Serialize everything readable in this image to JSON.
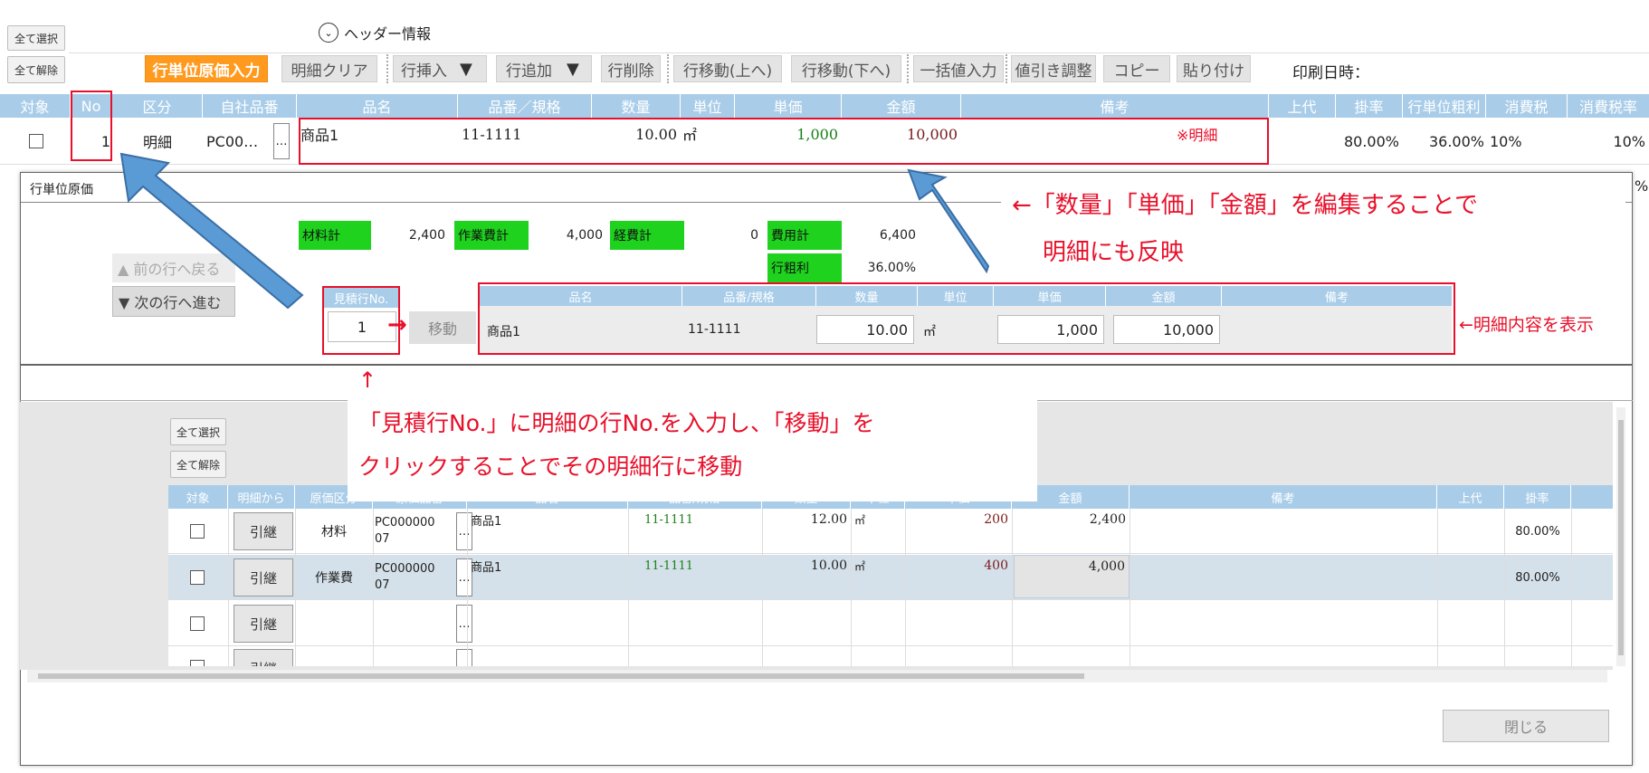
{
  "header_toggle": {
    "label": "ヘッダー情報"
  },
  "left_buttons": {
    "select_all": "全て選択",
    "deselect_all": "全て解除"
  },
  "toolbar": {
    "row_cost": "行単位原価入力",
    "clear": "明細クリア",
    "insert": "行挿入",
    "add": "行追加",
    "delete": "行削除",
    "move_up": "行移動(上へ)",
    "move_down": "行移動(下へ)",
    "bulk": "一括値入力",
    "discount": "値引き調整",
    "copy": "コピー",
    "paste": "貼り付け",
    "print_date": "印刷日時："
  },
  "main_table": {
    "headers": [
      "対象",
      "No",
      "区分",
      "自社品番",
      "品名",
      "品番／規格",
      "数量",
      "単位",
      "単価",
      "金額",
      "備考",
      "上代",
      "掛率",
      "行単位粗利",
      "消費税",
      "消費税率"
    ],
    "row": {
      "no": "1",
      "kubun": "明細",
      "code": "PC00…",
      "dots": "…",
      "name": "商品1",
      "spec": "11-1111",
      "qty": "10.00",
      "unit": "㎡",
      "price": "1,000",
      "amount": "10,000",
      "note": "※明細",
      "rate": "80.00%",
      "profit": "36.00%",
      "tax": "10%",
      "taxrate": "10%"
    },
    "pct_tail": "%"
  },
  "dialog": {
    "title": "行単位原価",
    "prev_row": "▲ 前の行へ戻る",
    "next_row": "▼ 次の行へ進む",
    "totals": {
      "material_label": "材料計",
      "material_value": "2,400",
      "work_label": "作業費計",
      "work_value": "4,000",
      "expense_label": "経費計",
      "expense_value": "0",
      "cost_label": "費用計",
      "cost_value": "6,400",
      "profit_label": "行粗利",
      "profit_value": "36.00%"
    },
    "row_no_label": "見積行No.",
    "row_no_value": "1",
    "move_button": "移動",
    "detail": {
      "headers": [
        "品名",
        "品番/規格",
        "数量",
        "単位",
        "単価",
        "金額",
        "備考"
      ],
      "name": "商品1",
      "spec": "11-1111",
      "qty": "10.00",
      "unit": "㎡",
      "price": "1,000",
      "amount": "10,000"
    },
    "sub": {
      "select_all": "全て選択",
      "deselect_all": "全て解除",
      "headers": [
        "対象",
        "明細から",
        "原価区分",
        "原価品番",
        "品名",
        "品番/規格",
        "数量",
        "単位",
        "単価",
        "金額",
        "備考",
        "上代",
        "掛率"
      ],
      "rows": [
        {
          "btn": "引継",
          "kubun": "材料",
          "code": "PC00000007",
          "name": "商品1",
          "spec": "11-1111",
          "qty": "12.00",
          "unit": "㎡",
          "price": "200",
          "amount": "2,400",
          "rate": "80.00%"
        },
        {
          "btn": "引継",
          "kubun": "作業費",
          "code": "PC00000007",
          "name": "商品1",
          "spec": "11-1111",
          "qty": "10.00",
          "unit": "㎡",
          "price": "400",
          "amount": "4,000",
          "rate": "80.00%"
        },
        {
          "btn": "引継",
          "kubun": "",
          "code": "",
          "name": "",
          "spec": "",
          "qty": "",
          "unit": "",
          "price": "",
          "amount": "",
          "rate": ""
        },
        {
          "btn": "引継"
        }
      ]
    },
    "close": "閉じる"
  },
  "annotations": {
    "detail_mark": "※明細",
    "edit_line1": "←「数量」「単価」「金額」を編集することで",
    "edit_line2": "明細にも反映",
    "show_detail": "←明細内容を表示",
    "up_arrow": "↑",
    "move_line1": "「見積行No.」に明細の行No.を入力し、「移動」を",
    "move_line2": "クリックすることでその明細行に移動",
    "right_arrow": "→"
  },
  "colors": {
    "header_blue": "#a9cde9",
    "accent_orange": "#ff9a1f",
    "annotation_red": "#e8102a",
    "total_green": "#1ed21e",
    "arrow_blue": "#5b9bd5"
  }
}
